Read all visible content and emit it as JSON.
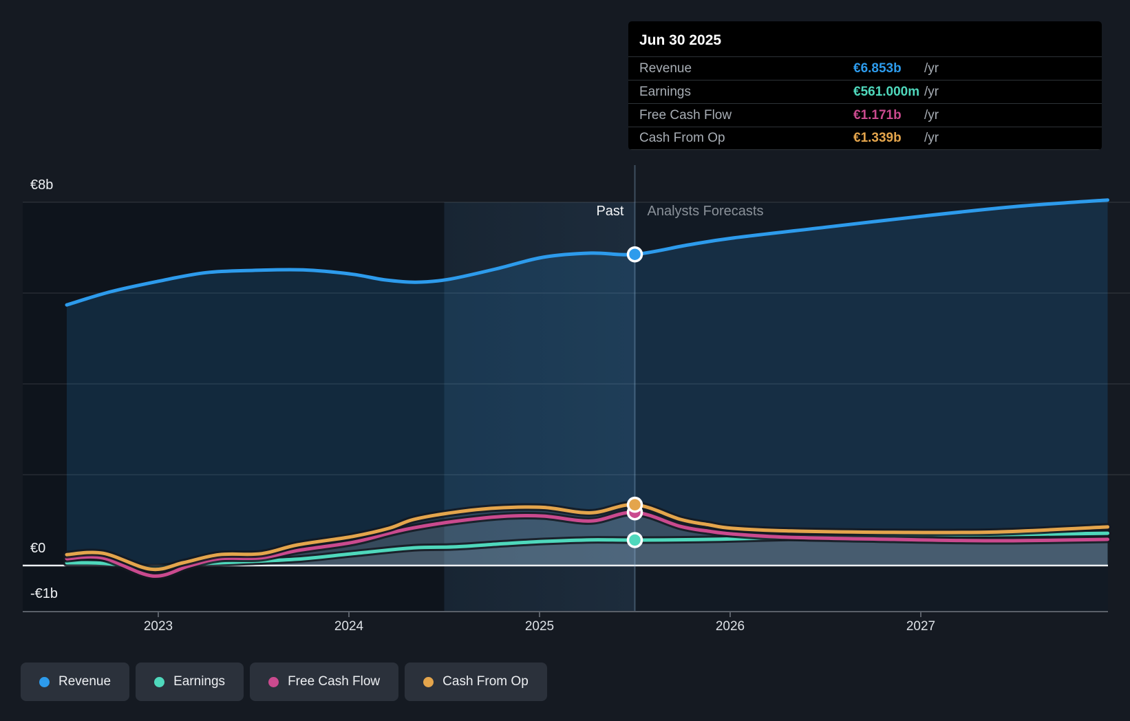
{
  "tooltip": {
    "date": "Jun 30 2025",
    "rows": [
      {
        "value": "€6.853b",
        "unit": "/yr"
      },
      {
        "value": "€561.000m",
        "unit": "/yr"
      },
      {
        "value": "€1.171b",
        "unit": "/yr"
      },
      {
        "value": "€1.339b",
        "unit": "/yr"
      }
    ]
  },
  "zones": {
    "past": "Past",
    "forecast": "Analysts Forecasts"
  },
  "chart_data": {
    "type": "line",
    "currency": "EUR",
    "x_ticks": [
      2023,
      2024,
      2025,
      2026,
      2027
    ],
    "x_tick_labels": [
      "2023",
      "2024",
      "2025",
      "2026",
      "2027"
    ],
    "x_range": [
      2022.5,
      2028.0
    ],
    "y_axis_marks": [
      {
        "v": 8,
        "label": "€8b"
      },
      {
        "v": 0,
        "label": "€0"
      },
      {
        "v": -1,
        "label": "-€1b"
      }
    ],
    "y_gridline_values": [
      8,
      6,
      4,
      2
    ],
    "y_range_billions": [
      -1,
      8
    ],
    "past_band": [
      2024.5,
      2025.5
    ],
    "marker": {
      "t": 2025.5,
      "date": "Jun 30 2025",
      "values": [
        6.853,
        0.561,
        1.171,
        1.339
      ]
    },
    "series": [
      {
        "name": "Revenue",
        "color": "#2D9BEC",
        "points": [
          [
            2022.52,
            5.74
          ],
          [
            2022.75,
            6.03
          ],
          [
            2023.0,
            6.26
          ],
          [
            2023.25,
            6.45
          ],
          [
            2023.5,
            6.5
          ],
          [
            2023.76,
            6.51
          ],
          [
            2024.01,
            6.42
          ],
          [
            2024.19,
            6.29
          ],
          [
            2024.35,
            6.24
          ],
          [
            2024.52,
            6.3
          ],
          [
            2024.77,
            6.53
          ],
          [
            2025.02,
            6.79
          ],
          [
            2025.27,
            6.88
          ],
          [
            2025.5,
            6.853
          ],
          [
            2025.78,
            7.06
          ],
          [
            2026.01,
            7.21
          ],
          [
            2026.5,
            7.45
          ],
          [
            2027.02,
            7.7
          ],
          [
            2027.51,
            7.91
          ],
          [
            2027.98,
            8.05
          ]
        ]
      },
      {
        "name": "Earnings",
        "color": "#4FD8BC",
        "points": [
          [
            2022.52,
            0.06
          ],
          [
            2022.71,
            0.05
          ],
          [
            2022.96,
            -0.05
          ],
          [
            2023.18,
            0.03
          ],
          [
            2023.43,
            0.08
          ],
          [
            2023.73,
            0.14
          ],
          [
            2024.02,
            0.26
          ],
          [
            2024.34,
            0.39
          ],
          [
            2024.55,
            0.41
          ],
          [
            2024.81,
            0.48
          ],
          [
            2025.02,
            0.53
          ],
          [
            2025.27,
            0.565
          ],
          [
            2025.5,
            0.561
          ],
          [
            2025.89,
            0.575
          ],
          [
            2026.32,
            0.62
          ],
          [
            2026.86,
            0.65
          ],
          [
            2027.4,
            0.68
          ],
          [
            2027.98,
            0.71
          ]
        ]
      },
      {
        "name": "Free Cash Flow",
        "color": "#CA4A8E",
        "points": [
          [
            2022.52,
            0.15
          ],
          [
            2022.71,
            0.165
          ],
          [
            2022.97,
            -0.23
          ],
          [
            2023.16,
            -0.01
          ],
          [
            2023.32,
            0.15
          ],
          [
            2023.54,
            0.17
          ],
          [
            2023.73,
            0.33
          ],
          [
            2024.02,
            0.51
          ],
          [
            2024.21,
            0.71
          ],
          [
            2024.34,
            0.83
          ],
          [
            2024.55,
            0.97
          ],
          [
            2024.8,
            1.08
          ],
          [
            2025.02,
            1.09
          ],
          [
            2025.27,
            0.98
          ],
          [
            2025.5,
            1.171
          ],
          [
            2025.74,
            0.86
          ],
          [
            2025.89,
            0.755
          ],
          [
            2026.01,
            0.695
          ],
          [
            2026.32,
            0.62
          ],
          [
            2026.86,
            0.575
          ],
          [
            2027.4,
            0.545
          ],
          [
            2027.98,
            0.575
          ]
        ]
      },
      {
        "name": "Cash From Op",
        "color": "#E4A54C",
        "points": [
          [
            2022.52,
            0.24
          ],
          [
            2022.71,
            0.27
          ],
          [
            2022.96,
            -0.08
          ],
          [
            2023.13,
            0.06
          ],
          [
            2023.32,
            0.24
          ],
          [
            2023.54,
            0.26
          ],
          [
            2023.73,
            0.455
          ],
          [
            2024.02,
            0.64
          ],
          [
            2024.21,
            0.82
          ],
          [
            2024.34,
            1.015
          ],
          [
            2024.55,
            1.17
          ],
          [
            2024.77,
            1.265
          ],
          [
            2025.02,
            1.28
          ],
          [
            2025.27,
            1.16
          ],
          [
            2025.5,
            1.339
          ],
          [
            2025.74,
            1.015
          ],
          [
            2025.89,
            0.895
          ],
          [
            2026.01,
            0.82
          ],
          [
            2026.32,
            0.76
          ],
          [
            2026.86,
            0.73
          ],
          [
            2027.4,
            0.74
          ],
          [
            2027.98,
            0.85
          ]
        ]
      }
    ]
  }
}
